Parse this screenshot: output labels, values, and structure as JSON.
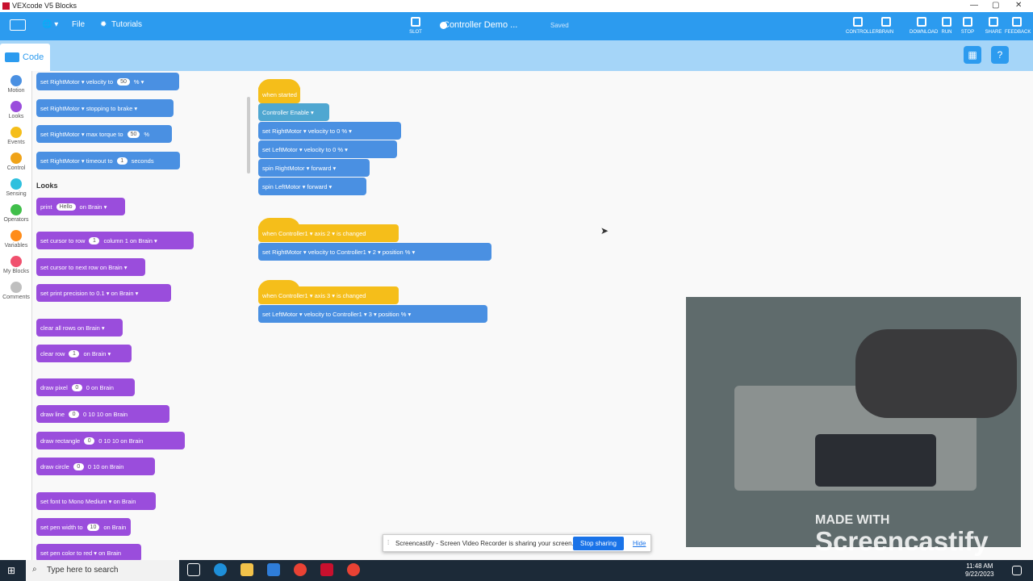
{
  "window": {
    "title": "VEXcode V5 Blocks"
  },
  "menu": {
    "file": "File",
    "tutorials": "Tutorials",
    "slot": "SLOT",
    "project_name": "Controller Demo ...",
    "status": "Saved"
  },
  "toolbar": {
    "controller": "CONTROLLER",
    "brain": "BRAIN",
    "download": "DOWNLOAD",
    "run": "RUN",
    "stop": "STOP",
    "share": "SHARE",
    "feedback": "FEEDBACK"
  },
  "tab": {
    "code": "Code"
  },
  "categories": [
    {
      "label": "Motion",
      "color": "#4a90e2"
    },
    {
      "label": "Looks",
      "color": "#9a4ddc"
    },
    {
      "label": "Events",
      "color": "#f5be1a"
    },
    {
      "label": "Control",
      "color": "#f0a318"
    },
    {
      "label": "Sensing",
      "color": "#2fc0de"
    },
    {
      "label": "Operators",
      "color": "#40bf4a"
    },
    {
      "label": "Variables",
      "color": "#ff8c1a"
    },
    {
      "label": "My Blocks",
      "color": "#f0506e"
    },
    {
      "label": "Comments",
      "color": "#bfbfbf"
    }
  ],
  "palette": {
    "section_looks": "Looks",
    "blocks": [
      {
        "text": "set  RightMotor ▾  velocity to",
        "val": "50",
        "tail": "% ▾"
      },
      {
        "text": "set  RightMotor ▾  stopping to  brake ▾",
        "val": "",
        "tail": ""
      },
      {
        "text": "set  RightMotor ▾  max torque to",
        "val": "50",
        "tail": "%"
      },
      {
        "text": "set  RightMotor ▾  timeout to",
        "val": "1",
        "tail": "seconds"
      },
      {
        "text": "print",
        "val": "Hello",
        "tail": "on  Brain ▾"
      },
      {
        "text": "set cursor to row",
        "val": "1",
        "tail": "column  1  on  Brain ▾"
      },
      {
        "text": "set cursor to next row on  Brain ▾",
        "val": "",
        "tail": ""
      },
      {
        "text": "set print precision to  0.1 ▾  on  Brain ▾",
        "val": "",
        "tail": ""
      },
      {
        "text": "clear all rows on  Brain ▾",
        "val": "",
        "tail": ""
      },
      {
        "text": "clear row",
        "val": "1",
        "tail": "on  Brain ▾"
      },
      {
        "text": "draw pixel",
        "val": "0",
        "tail": "0  on Brain"
      },
      {
        "text": "draw line",
        "val": "0",
        "tail": "0  10  10  on Brain"
      },
      {
        "text": "draw rectangle",
        "val": "0",
        "tail": "0  10  10  on Brain"
      },
      {
        "text": "draw circle",
        "val": "0",
        "tail": "0  10  on Brain"
      },
      {
        "text": "set font to  Mono Medium ▾  on Brain",
        "val": "",
        "tail": ""
      },
      {
        "text": "set pen width to",
        "val": "10",
        "tail": "on Brain"
      },
      {
        "text": "set pen color to  red ▾  on Brain",
        "val": "",
        "tail": ""
      }
    ]
  },
  "workspace": {
    "stack1": {
      "hat": "when started",
      "rows": [
        "Controller  Enable ▾",
        "set   RightMotor ▾   velocity to  0  % ▾",
        "set   LeftMotor ▾   velocity to  0  % ▾",
        "spin   RightMotor ▾      forward ▾",
        "spin   LeftMotor ▾      forward ▾"
      ]
    },
    "stack2": {
      "hat": "when  Controller1 ▾  axis  2 ▾  is changed",
      "row": "set   RightMotor ▾   velocity to   Controller1 ▾   2 ▾  position   % ▾"
    },
    "stack3": {
      "hat": "when  Controller1 ▾  axis  3 ▾  is changed",
      "row": "set   LeftMotor ▾   velocity to   Controller1 ▾   3 ▾  position   % ▾"
    }
  },
  "overlay": {
    "made_with": "MADE WITH",
    "brand": "Screencastify"
  },
  "share_bar": {
    "text": "Screencastify - Screen Video Recorder is sharing your screen.",
    "stop": "Stop sharing",
    "hide": "Hide"
  },
  "taskbar": {
    "search_placeholder": "Type here to search",
    "time": "11:48 AM",
    "date": "9/22/2023"
  }
}
